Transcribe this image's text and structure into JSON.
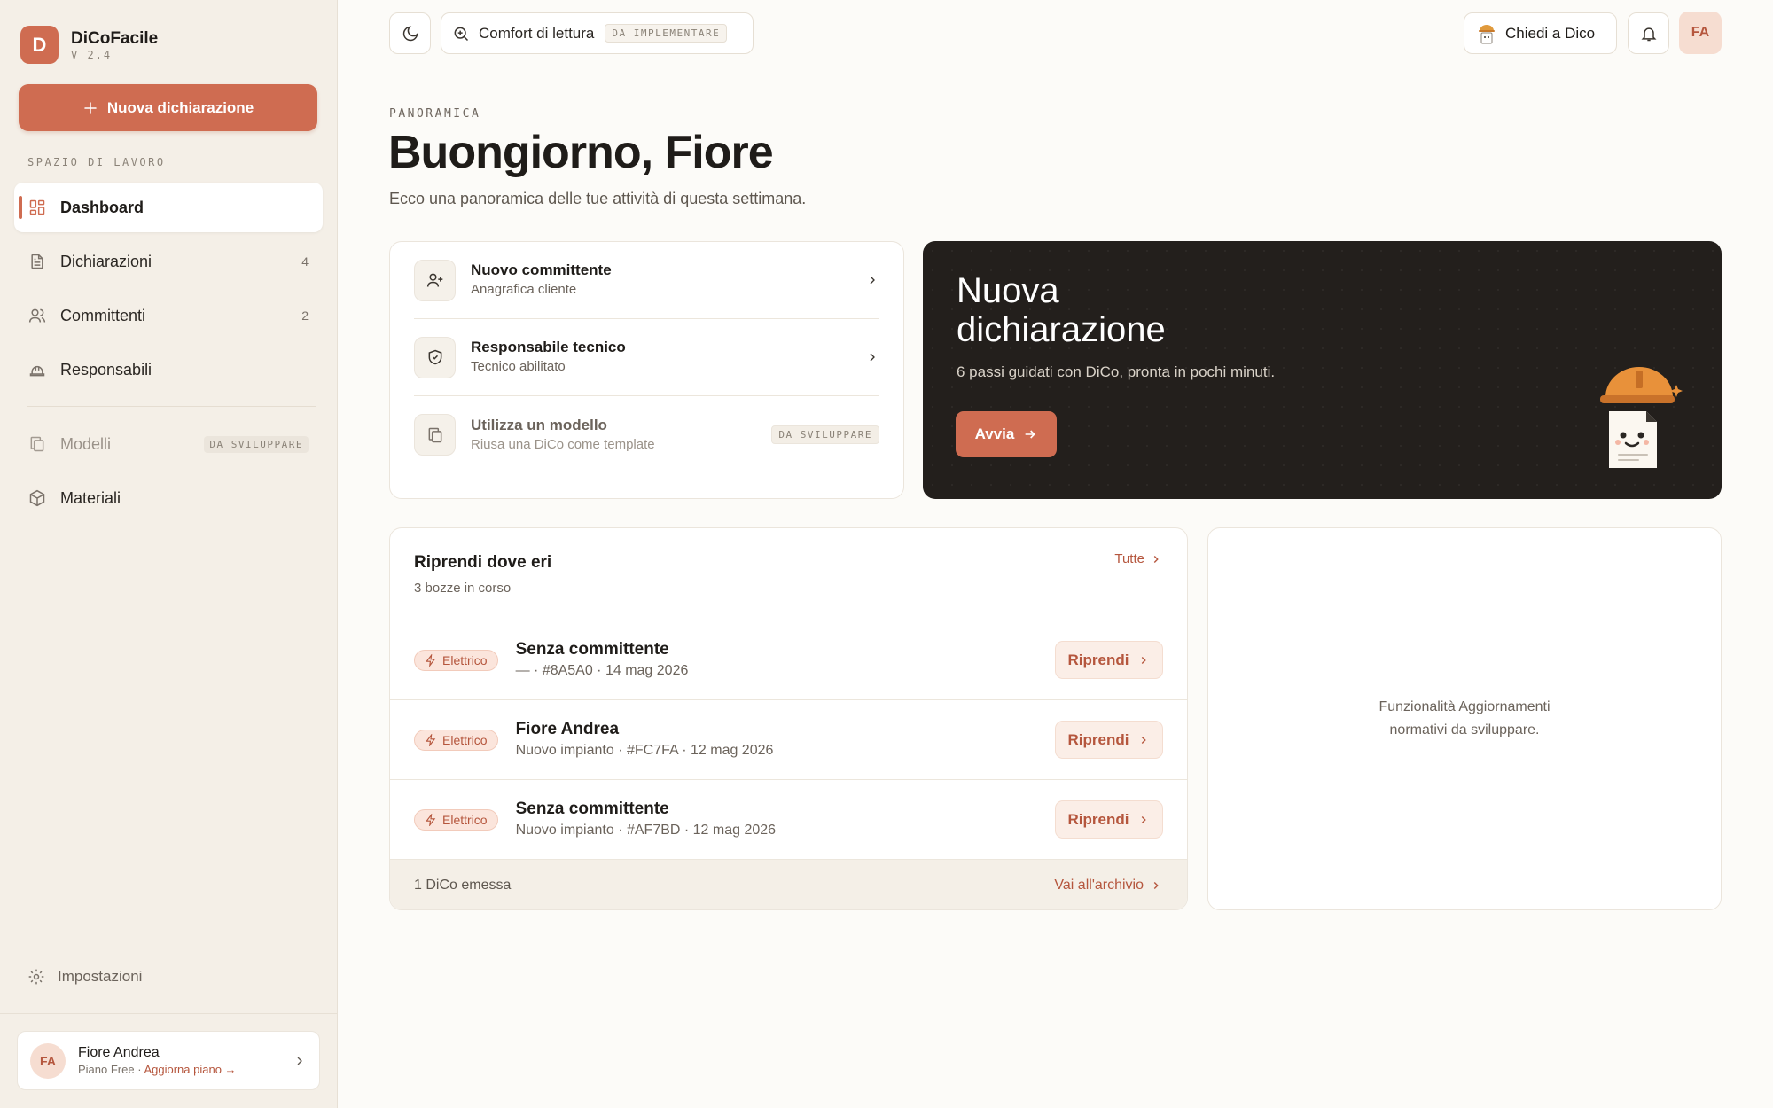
{
  "brand": {
    "logo_letter": "D",
    "name": "DiCoFacile",
    "version": "V 2.4"
  },
  "sidebar": {
    "new_button_label": "Nuova dichiarazione",
    "section_label": "SPAZIO DI LAVORO",
    "items": [
      {
        "label": "Dashboard",
        "icon": "grid-icon",
        "active": true
      },
      {
        "label": "Dichiarazioni",
        "icon": "document-icon",
        "count": "4"
      },
      {
        "label": "Committenti",
        "icon": "users-icon",
        "count": "2"
      },
      {
        "label": "Responsabili",
        "icon": "helmet-icon"
      },
      {
        "label": "Modelli",
        "icon": "copy-icon",
        "badge": "DA SVILUPPARE",
        "disabled": true
      },
      {
        "label": "Materiali",
        "icon": "box-icon"
      }
    ],
    "settings_label": "Impostazioni",
    "user": {
      "initials": "FA",
      "name": "Fiore Andrea",
      "plan": "Piano Free",
      "separator": "·",
      "upgrade": "Aggiorna piano →"
    }
  },
  "topbar": {
    "reading_label": "Comfort di lettura",
    "reading_badge": "DA IMPLEMENTARE",
    "ask_label": "Chiedi a Dico",
    "avatar_initials": "FA"
  },
  "header": {
    "eyebrow": "PANORAMICA",
    "title": "Buongiorno, Fiore",
    "subtitle": "Ecco una panoramica delle tue attività di questa settimana."
  },
  "quick_actions": [
    {
      "title": "Nuovo committente",
      "subtitle": "Anagrafica cliente",
      "icon": "user-plus-icon"
    },
    {
      "title": "Responsabile tecnico",
      "subtitle": "Tecnico abilitato",
      "icon": "shield-check-icon"
    },
    {
      "title": "Utilizza un modello",
      "subtitle": "Riusa una DiCo come template",
      "icon": "copy-icon",
      "badge": "DA SVILUPPARE"
    }
  ],
  "hero": {
    "title": "Nuova dichiarazione",
    "subtitle": "6 passi guidati con DiCo, pronta in pochi minuti.",
    "button_label": "Avvia"
  },
  "resume": {
    "title": "Riprendi dove eri",
    "subtitle": "3 bozze in corso",
    "all_label": "Tutte",
    "drafts": [
      {
        "tag": "Elettrico",
        "title": "Senza committente",
        "meta": "— · #8A5A0 · 14 mag 2026",
        "button": "Riprendi"
      },
      {
        "tag": "Elettrico",
        "title": "Fiore Andrea",
        "meta": "Nuovo impianto · #FC7FA · 12 mag 2026",
        "button": "Riprendi"
      },
      {
        "tag": "Elettrico",
        "title": "Senza committente",
        "meta": "Nuovo impianto · #AF7BD · 12 mag 2026",
        "button": "Riprendi"
      }
    ],
    "footer_count": "1 DiCo emessa",
    "footer_link": "Vai all'archivio"
  },
  "updates": {
    "text": "Funzionalità Aggiornamenti normativi da sviluppare."
  },
  "colors": {
    "accent": "#cf6c51",
    "accent_dark": "#b5563d",
    "hero_bg": "#231f1c",
    "sidebar_bg": "#f4efe7"
  }
}
